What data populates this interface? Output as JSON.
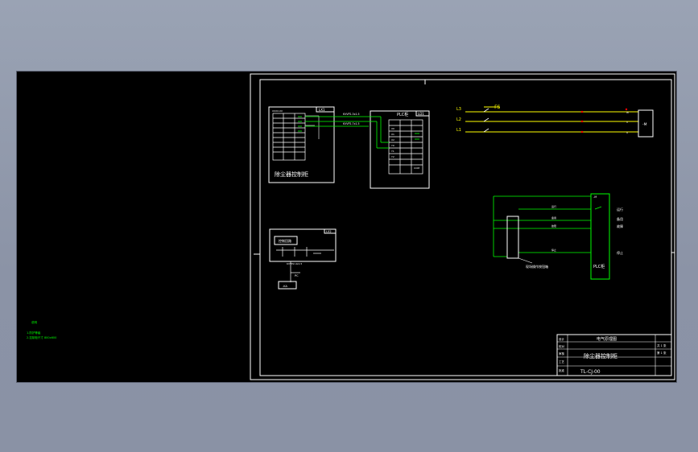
{
  "model_space_notes": [
    "说明",
    "1.防护等级",
    "2.控制柜尺寸 800x600"
  ],
  "cabinet": {
    "title": "除尘器控制柜",
    "terminal_tag": "LX1",
    "header_text": "XXXX-XX",
    "cable_labels": [
      "KVVP2-3x1.5",
      "KVVP2-7x1.5"
    ]
  },
  "plc": {
    "title": "PLC柜",
    "tag": "LD1",
    "terminals": [
      "X0",
      "X1",
      "X2",
      "Y0",
      "Y1",
      "Y2",
      "COM"
    ]
  },
  "power": {
    "phases": [
      "L3",
      "L2",
      "L1"
    ],
    "breaker_label": "-FS",
    "motor_label": "-M",
    "motor_terminals": [
      "W",
      "V",
      "U"
    ]
  },
  "field": {
    "plc_label": "PLC柜",
    "panel_label": "现场操作按钮箱",
    "signal_labels": [
      "运行",
      "备用",
      "故障",
      "停止"
    ],
    "side_labels": [
      "运行",
      "备用",
      "故障",
      "停止"
    ],
    "tag": "-M"
  },
  "aux": {
    "tag": "LX2",
    "inner_label": "控制回路",
    "cable_label": "KVVP2-4x1.5",
    "pc_label": "PC",
    "bottom_label": "-KA"
  },
  "title_block": {
    "project": "电气原理图",
    "drawing_name": "除尘器控制柜",
    "sheet": "共 1 张",
    "page": "第 1 张",
    "number": "TL-CJ-00",
    "rows": [
      "设计",
      "校对",
      "审核",
      "工艺",
      "批准"
    ]
  },
  "colors": {
    "background": "#000000",
    "linework": "#ffffff",
    "wires": "#ffff00",
    "signals": "#00ff00",
    "accent": "#ff0000"
  }
}
